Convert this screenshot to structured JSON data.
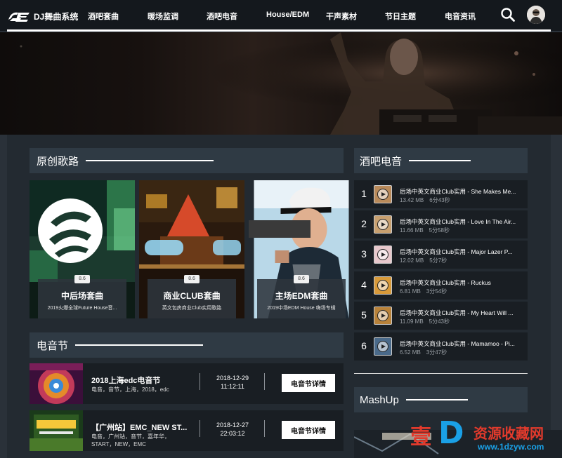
{
  "header": {
    "logo_text": "DJ舞曲系统",
    "nav": [
      {
        "label": "酒吧套曲"
      },
      {
        "label": "暖场监调"
      },
      {
        "label": "酒吧电音"
      },
      {
        "label": "House/EDM"
      },
      {
        "label": "干声素材"
      },
      {
        "label": "节日主题"
      },
      {
        "label": "电音资讯"
      }
    ],
    "search_icon": "search-icon",
    "avatar_icon": "user-avatar"
  },
  "original": {
    "title": "原创歌路",
    "cards": [
      {
        "score": "8.6",
        "title": "中后场套曲",
        "desc": "2019火爆全球Future House音..."
      },
      {
        "score": "8.6",
        "title": "商业CLUB套曲",
        "desc": "英文包房商业Club实用歌路"
      },
      {
        "score": "8.6",
        "title": "主场EDM套曲",
        "desc": "2019中场EDM House 嗨场专辑"
      }
    ]
  },
  "festival": {
    "title": "电音节",
    "items": [
      {
        "title": "2018上海edc电音节",
        "tags": "电音，音节，上海，2018，edc",
        "date": "2018-12-29",
        "time": "11:12:11",
        "button": "电音节详情"
      },
      {
        "title": "【广州站】EMC_NEW ST...",
        "tags": "电音，广州站，音节，嘉年华，START，NEW，EMC",
        "date": "2018-12-27",
        "time": "22:03:12",
        "button": "电音节详情"
      }
    ]
  },
  "bar": {
    "title": "酒吧电音",
    "tracks": [
      {
        "num": "1",
        "title": "后场中英文商业Club实用 - She Makes Me...",
        "size": "13.42 MB",
        "duration": "6分43秒"
      },
      {
        "num": "2",
        "title": "后场中英文商业Club实用 - Love In The Air...",
        "size": "11.66 MB",
        "duration": "5分58秒"
      },
      {
        "num": "3",
        "title": "后场中英文商业Club实用 - Major Lazer P...",
        "size": "12.02 MB",
        "duration": "5分7秒"
      },
      {
        "num": "4",
        "title": "后场中英文商业Club实用 - Ruckus",
        "size": "6.81 MB",
        "duration": "3分54秒"
      },
      {
        "num": "5",
        "title": "后场中英文商业Club实用 - My Heart Will ...",
        "size": "11.09 MB",
        "duration": "5分43秒"
      },
      {
        "num": "6",
        "title": "后场中英文商业Club实用 - Mamamoo - Pi...",
        "size": "6.52 MB",
        "duration": "3分47秒"
      }
    ]
  },
  "mashup": {
    "title": "MashUp"
  },
  "watermark": {
    "brand": "壹",
    "letter": "D",
    "cn": "资源收藏网",
    "url": "www.1dzyw.com"
  },
  "colors": {
    "page_bg": "#2a3139",
    "panel_bg": "#232a31",
    "header_bg": "#2f3a44",
    "row_bg": "#191e23",
    "accent_white": "#ffffff"
  }
}
